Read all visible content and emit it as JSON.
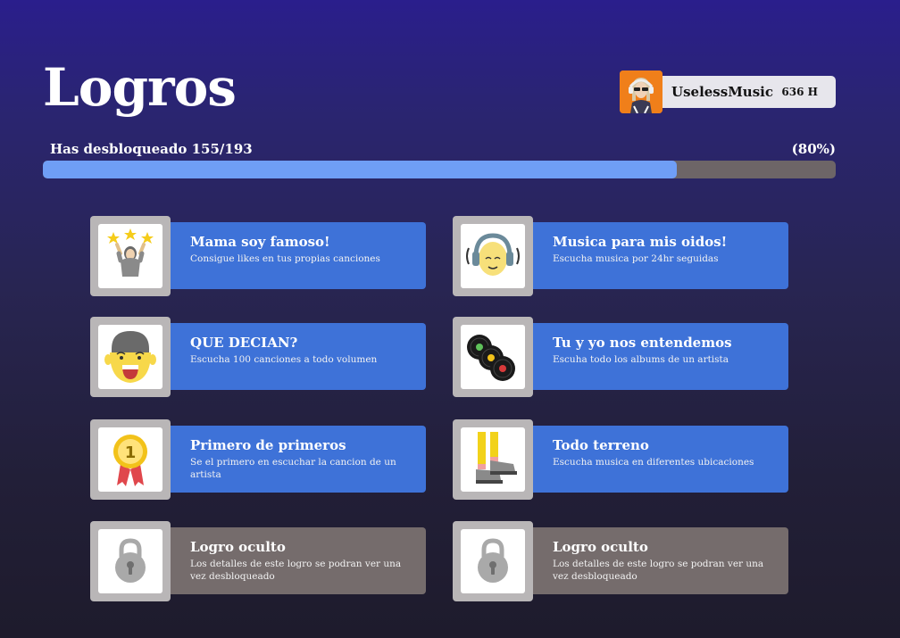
{
  "header": {
    "title": "Logros"
  },
  "profile": {
    "username": "UselessMusic",
    "hours": "636 H",
    "avatar_icon": "user-avatar"
  },
  "progress": {
    "label": "Has desbloqueado 155/193",
    "percent_text": "(80%)",
    "fraction": 0.8
  },
  "achievements": [
    {
      "title": "Mama soy famoso!",
      "desc": "Consigue likes en tus propias canciones",
      "icon": "famous-person-stars-icon",
      "locked": false
    },
    {
      "title": "Musica para mis oidos!",
      "desc": "Escucha musica por 24hr seguidas",
      "icon": "headphones-face-icon",
      "locked": false
    },
    {
      "title": "QUE DECIAN?",
      "desc": "Escucha 100 canciones a todo volumen",
      "icon": "shouting-face-icon",
      "locked": false
    },
    {
      "title": "Tu y yo nos entendemos",
      "desc": "Escuha todo los albums de un artista",
      "icon": "vinyl-records-icon",
      "locked": false
    },
    {
      "title": "Primero de primeros",
      "desc": "Se el primero en escuchar la cancion de un artista",
      "icon": "first-place-medal-icon",
      "locked": false
    },
    {
      "title": "Todo terreno",
      "desc": "Escucha musica en diferentes ubicaciones",
      "icon": "walking-legs-icon",
      "locked": false
    },
    {
      "title": "Logro oculto",
      "desc": "Los detalles de este logro se podran ver una vez desbloqueado",
      "icon": "padlock-icon",
      "locked": true
    },
    {
      "title": "Logro oculto",
      "desc": "Los detalles de este logro se podran ver una vez desbloqueado",
      "icon": "padlock-icon",
      "locked": true
    }
  ],
  "colors": {
    "accent": "#3e72d8",
    "progress_fill": "#6f9ef6",
    "locked": "#756c6c"
  }
}
